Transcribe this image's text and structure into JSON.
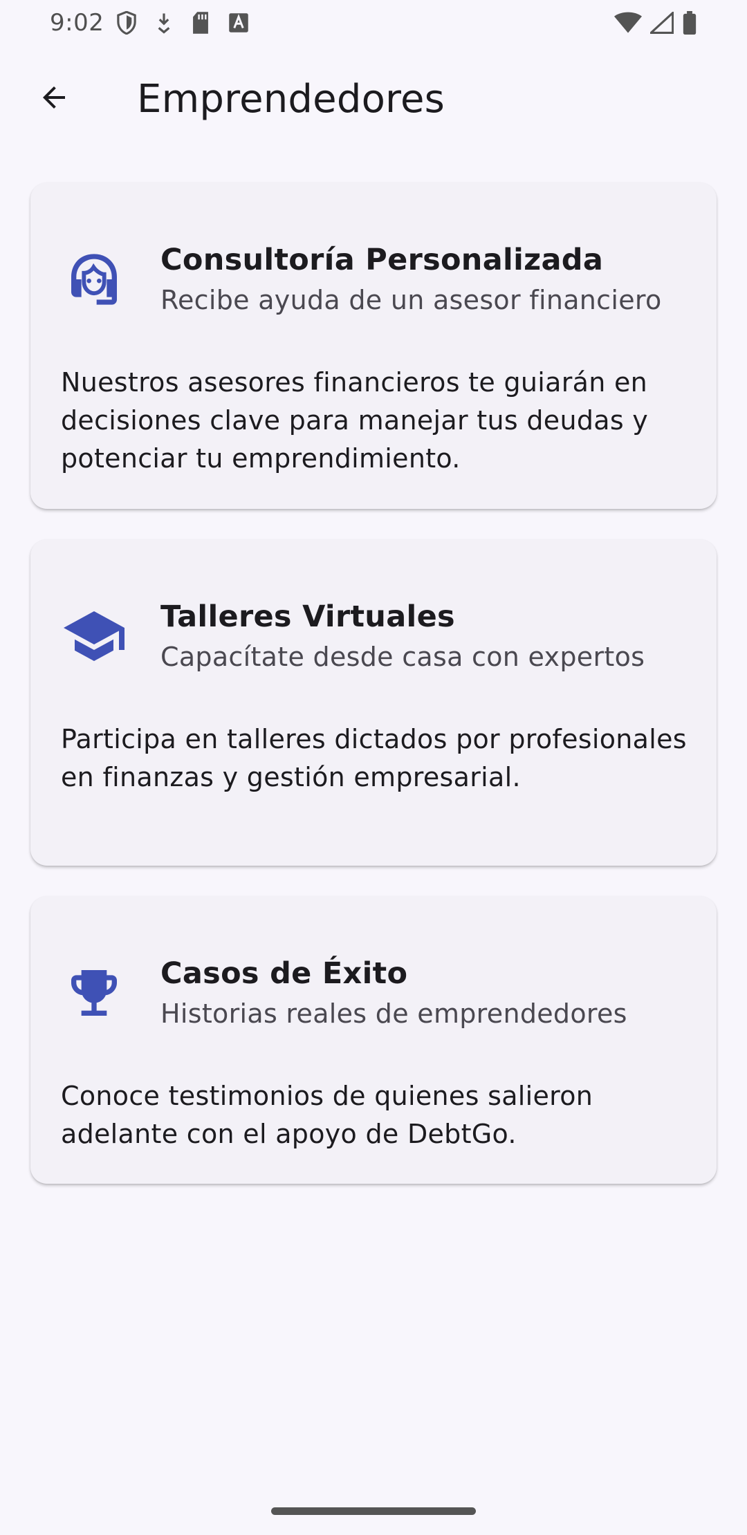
{
  "status_bar": {
    "time": "9:02",
    "left_icons": [
      "shield-icon",
      "download-icon",
      "sd-card-icon",
      "font-a-icon"
    ],
    "right_icons": [
      "wifi-icon",
      "cell-signal-icon",
      "battery-icon"
    ]
  },
  "app_bar": {
    "back_icon": "arrow-back-icon",
    "title": "Emprendedores"
  },
  "cards": [
    {
      "icon": "headset-support-icon",
      "title": "Consultoría Personalizada",
      "subtitle": "Recibe ayuda de un asesor financiero",
      "body": "Nuestros asesores financieros te guiarán en decisiones clave para manejar tus deudas y potenciar tu emprendimiento."
    },
    {
      "icon": "graduation-cap-icon",
      "title": "Talleres Virtuales",
      "subtitle": "Capacítate desde casa con expertos",
      "body": "Participa en talleres dictados por profesionales en finanzas y gestión empresarial."
    },
    {
      "icon": "trophy-icon",
      "title": "Casos de Éxito",
      "subtitle": "Historias reales de emprendedores",
      "body": "Conoce testimonios de quienes salieron adelante con el apoyo de DebtGo."
    }
  ],
  "colors": {
    "background": "#f8f6fc",
    "card_background": "#f3f1f7",
    "accent_icon": "#3f51b5",
    "text_primary": "#1c1b1f",
    "text_secondary": "#4a4850"
  }
}
